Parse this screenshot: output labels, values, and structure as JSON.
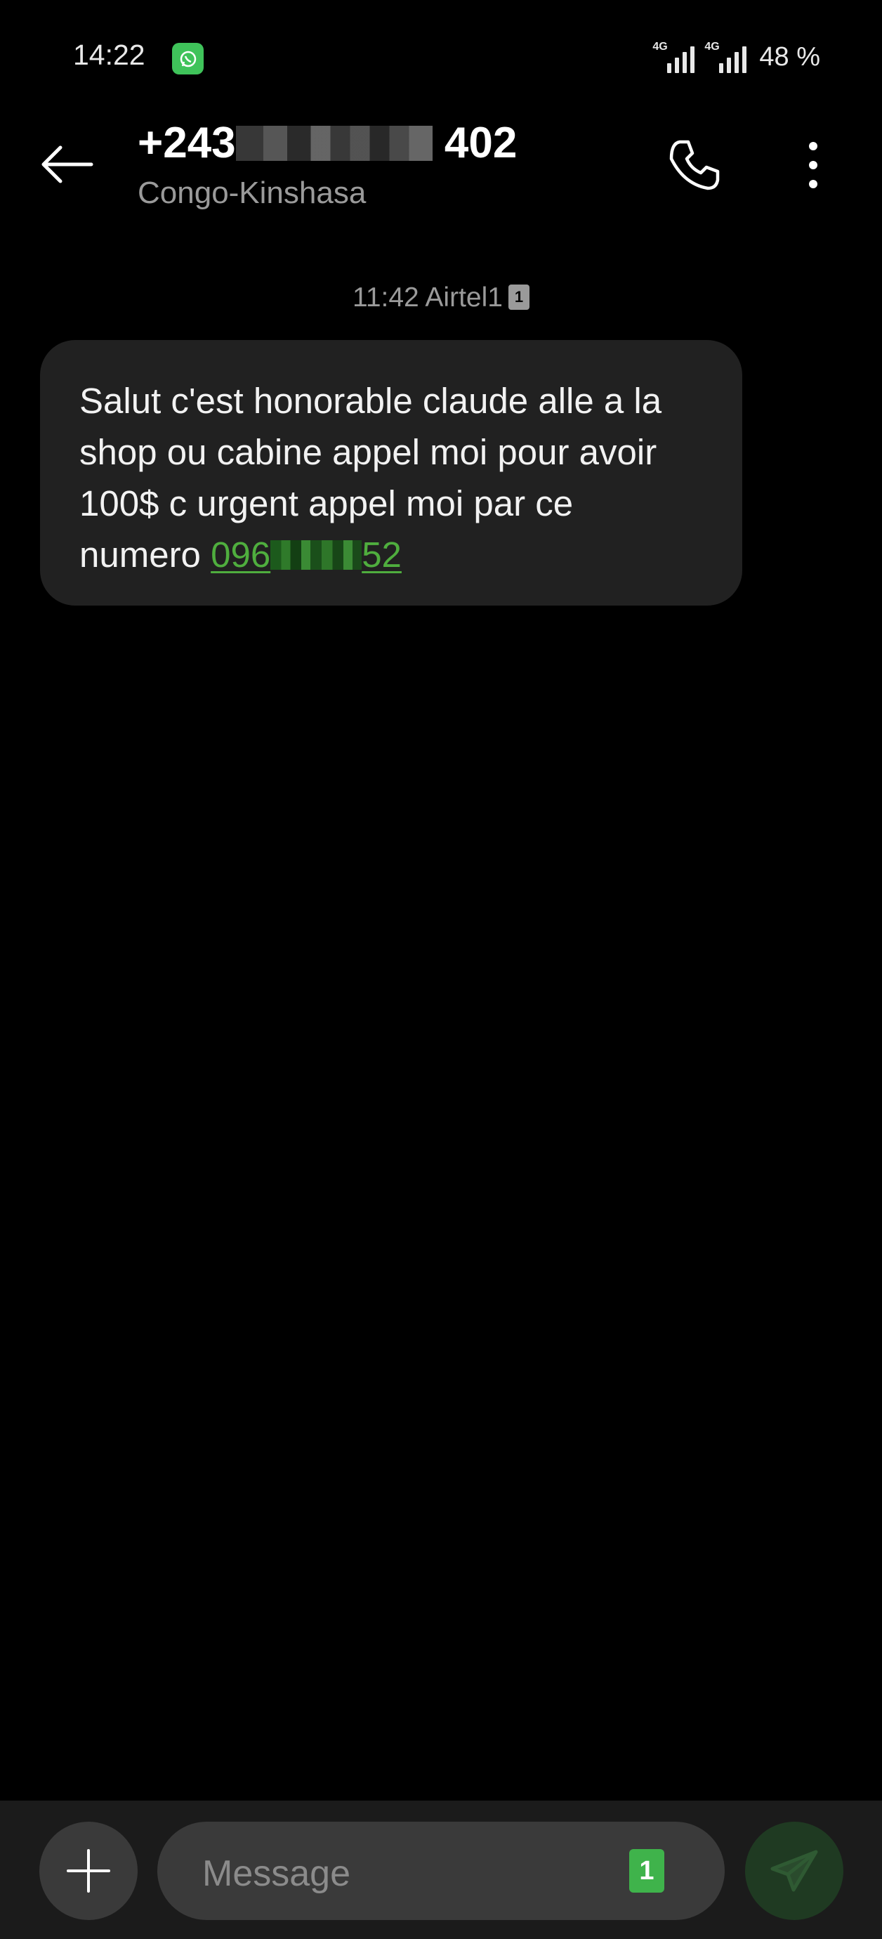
{
  "status_bar": {
    "time": "14:22",
    "notification_icon": "whatsapp-icon",
    "network_1": "4G",
    "network_2": "4G",
    "battery": "48 %"
  },
  "header": {
    "number_prefix": "+243",
    "number_suffix": " 402",
    "country": "Congo-Kinshasa",
    "icons": {
      "back": "arrow-left-icon",
      "call": "phone-icon",
      "more": "more-vertical-icon"
    }
  },
  "conversation": {
    "meta_time": "11:42",
    "meta_sim": "Airtel1",
    "meta_sim_badge": "1",
    "message_text": "Salut c'est honorable claude alle a la shop ou cabine appel moi pour avoir 100$ c urgent appel moi par ce numero ",
    "link_prefix": "096",
    "link_suffix": "52"
  },
  "composer": {
    "placeholder": "Message",
    "sim_label": "1",
    "icons": {
      "attach": "plus-icon",
      "send": "send-icon"
    }
  },
  "colors": {
    "background": "#000000",
    "bubble": "#212121",
    "link": "#4fae3e",
    "accent_green": "#3fb34b"
  }
}
